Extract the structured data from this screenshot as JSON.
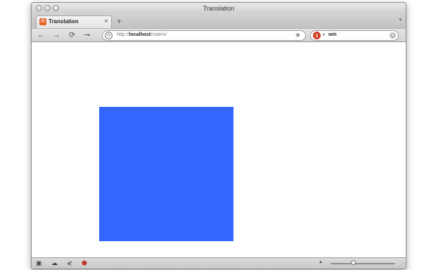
{
  "window": {
    "title": "Translation"
  },
  "tabs": [
    {
      "label": "Translation",
      "close": "×"
    }
  ],
  "toolbar": {
    "back": "←",
    "forward": "→",
    "reload": "⟳",
    "key": "⊸",
    "new_tab": "+",
    "tab_list": "▾"
  },
  "address": {
    "prefix": "http://",
    "host": "localhost",
    "path": "/matrix/",
    "star": "★",
    "site_icon": "⊙"
  },
  "search": {
    "query": "win",
    "engine_icon": "g",
    "dropdown": "▾",
    "clear": "×"
  },
  "content": {
    "square_color": "#3366ff"
  },
  "statusbar": {
    "icons": [
      "console-icon",
      "cloud-icon",
      "share-icon",
      "addon-icon"
    ],
    "zoom_level": 0.35
  }
}
